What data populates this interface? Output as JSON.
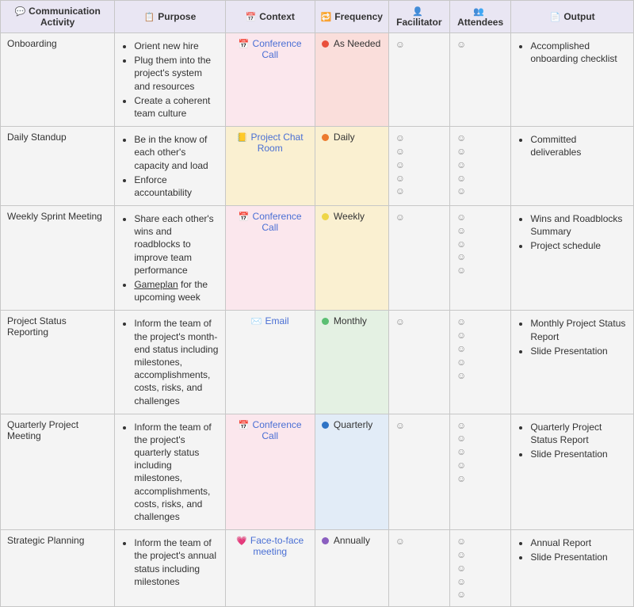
{
  "headers": {
    "activity": "Communication Activity",
    "purpose": "Purpose",
    "context": "Context",
    "frequency": "Frequency",
    "facilitator": "Facilitator",
    "attendees": "Attendees",
    "output": "Output"
  },
  "headerIcons": {
    "activity": "💬",
    "purpose": "📋",
    "context": "📅",
    "frequency": "🔁",
    "facilitator": "👤",
    "attendees": "👥",
    "output": "📄"
  },
  "context": {
    "conference": "Conference Call",
    "chat": "Project Chat Room",
    "email": "Email",
    "f2f": "Face-to-face meeting"
  },
  "contextIcons": {
    "conference": "📅",
    "chat": "📒",
    "email": "✉️",
    "f2f": "💗"
  },
  "freq": {
    "asneeded": "As Needed",
    "daily": "Daily",
    "weekly": "Weekly",
    "monthly": "Monthly",
    "quarterly": "Quarterly",
    "annually": "Annually"
  },
  "rows": [
    {
      "activity": "Onboarding",
      "purpose": [
        "Orient new hire",
        "Plug them into the project's system and resources",
        "Create a coherent team culture"
      ],
      "contextKey": "conference",
      "contextBg": "bg-pink",
      "freqKey": "asneeded",
      "freqDot": "d-red",
      "freqBg": "bg-red",
      "facilitator": 1,
      "attendees": 1,
      "output": [
        "Accomplished onboarding checklist"
      ]
    },
    {
      "activity": "Daily Standup",
      "purpose": [
        "Be in the know of each other's capacity and load",
        "Enforce accountability"
      ],
      "contextKey": "chat",
      "contextBg": "bg-yellow",
      "freqKey": "daily",
      "freqDot": "d-orange",
      "freqBg": "bg-yellow",
      "facilitator": 5,
      "attendees": 5,
      "output": [
        "Committed deliverables"
      ]
    },
    {
      "activity": "Weekly Sprint Meeting",
      "purpose": [
        "Share each other's wins and roadblocks to improve team performance",
        "<u>Gameplan</u> for the upcoming week"
      ],
      "contextKey": "conference",
      "contextBg": "bg-pink",
      "freqKey": "weekly",
      "freqDot": "d-yellow",
      "freqBg": "bg-yellow",
      "facilitator": 1,
      "attendees": 5,
      "output": [
        "Wins and Roadblocks Summary",
        "Project schedule"
      ]
    },
    {
      "activity": "Project Status Reporting",
      "purpose": [
        "Inform the team of the project's month-end status including milestones, accomplishments, costs, risks, and challenges"
      ],
      "contextKey": "email",
      "contextBg": "",
      "freqKey": "monthly",
      "freqDot": "d-green",
      "freqBg": "bg-green",
      "facilitator": 1,
      "attendees": 5,
      "output": [
        "Monthly Project Status Report",
        "Slide Presentation"
      ]
    },
    {
      "activity": "Quarterly Project Meeting",
      "purpose": [
        "Inform the team of the project's quarterly status including milestones, accomplishments, costs, risks, and challenges"
      ],
      "contextKey": "conference",
      "contextBg": "bg-pink",
      "freqKey": "quarterly",
      "freqDot": "d-blue",
      "freqBg": "bg-blue2",
      "facilitator": 1,
      "attendees": 5,
      "output": [
        "Quarterly Project Status Report",
        "Slide Presentation"
      ]
    },
    {
      "activity": "Strategic Planning",
      "purpose": [
        "Inform the team of the project's annual status including milestones"
      ],
      "contextKey": "f2f",
      "contextBg": "",
      "freqKey": "annually",
      "freqDot": "d-purple",
      "freqBg": "",
      "facilitator": 1,
      "attendees": 5,
      "output": [
        "Annual Report",
        "Slide Presentation"
      ]
    }
  ]
}
